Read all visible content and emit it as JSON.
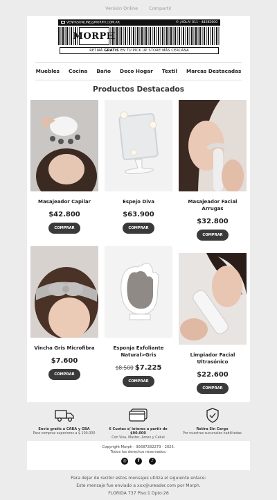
{
  "top_links": {
    "online": "Versión Online",
    "share": "Compartir"
  },
  "banner": {
    "email": "VENTASONLINE@MORPH.COM.AR",
    "phone": "¡HOLA! 011 - 48285600",
    "logo": "MORPH",
    "strip_pre": "RETIRÁ",
    "strip_bold": "GRATIS",
    "strip_post": "EN TU PICK UP STORE MÁS CERCANA"
  },
  "nav": [
    "Muebles",
    "Cocina",
    "Baño",
    "Deco Hogar",
    "Textil",
    "Marcas Destacadas"
  ],
  "section_title": "Productos Destacados",
  "products": [
    {
      "name": "Masajeador Capilar",
      "price": "$42.800",
      "old_price": "",
      "button": "COMPRAR"
    },
    {
      "name": "Espejo Diva",
      "price": "$63.900",
      "old_price": "",
      "button": "COMPRAR"
    },
    {
      "name": "Masajeador Facial Arrugas",
      "price": "$32.800",
      "old_price": "",
      "button": "COMPRAR"
    },
    {
      "name": "Vincha Gris Microfibra",
      "price": "$7.600",
      "old_price": "",
      "button": "COMPRAR"
    },
    {
      "name": "Esponja Exfoliante Natural>Gris",
      "price": "$7.225",
      "old_price": "$8.500",
      "button": "COMPRAR"
    },
    {
      "name": "Limpiador Facial Ultrasónico",
      "price": "$22.600",
      "old_price": "",
      "button": "COMPRAR"
    }
  ],
  "benefits": [
    {
      "icon": "truck-icon",
      "title": "Envío gratis a CABA y GBA",
      "sub": "Para compras superiores a $ 100.000"
    },
    {
      "icon": "credit-card-icon",
      "title": "6 Cuotas s/ interes a partir de $90.000",
      "sub": "Con Visa, Master, Amex y Cabal"
    },
    {
      "icon": "shield-check-icon",
      "title": "Retira Sin Cargo",
      "sub": "Por nuestras sucursales habilitadas"
    }
  ],
  "copyright": {
    "line1": "Copyright Morph - 30687282279 - 2025.",
    "line2": "Todos los derechos reservados."
  },
  "socials": [
    "instagram-icon",
    "facebook-icon",
    "tiktok-icon"
  ],
  "unsubscribe": {
    "line1": "Para dejar de recibir estos mensajes utiliza el siguiente enlace:",
    "line2": "Este mensaje fue enviado a xxx@ureader.com por Morph.",
    "line3": "FLORIDA 737 Piso:1 Dpto:26"
  },
  "colors": {
    "button_bg": "#3a3a3a",
    "page_bg": "#ececec",
    "card_bg": "#ffffff"
  }
}
